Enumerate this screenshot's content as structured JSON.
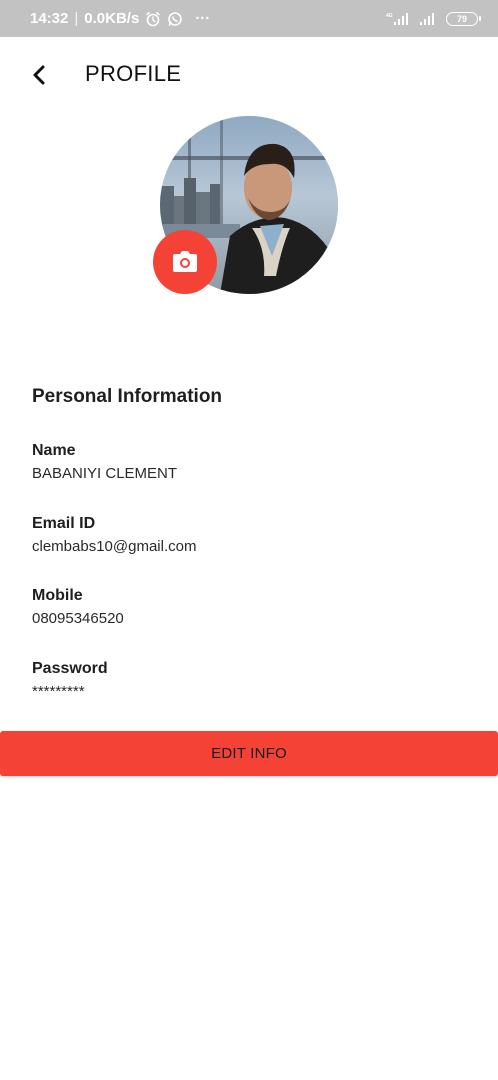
{
  "status_bar": {
    "time": "14:32",
    "speed": "0.0KB/s",
    "more": "···",
    "network": "4G",
    "battery": "79",
    "icons": [
      "alarm-icon",
      "whatsapp-icon",
      "signal-icon",
      "battery-icon"
    ]
  },
  "header": {
    "title": "PROFILE",
    "back_icon": "back-arrow-icon"
  },
  "profile": {
    "avatar_alt": "profile-photo",
    "camera_icon": "camera-icon"
  },
  "section": {
    "title": "Personal Information"
  },
  "fields": {
    "name_label": "Name",
    "name_value": "BABANIYI CLEMENT",
    "email_label": "Email ID",
    "email_value": "clembabs10@gmail.com",
    "mobile_label": "Mobile",
    "mobile_value": "08095346520",
    "password_label": "Password",
    "password_value": "*********"
  },
  "actions": {
    "edit_label": "EDIT INFO"
  },
  "colors": {
    "accent": "#f44336",
    "status_bar": "#c2c2c2",
    "text": "#1f1f1f"
  }
}
